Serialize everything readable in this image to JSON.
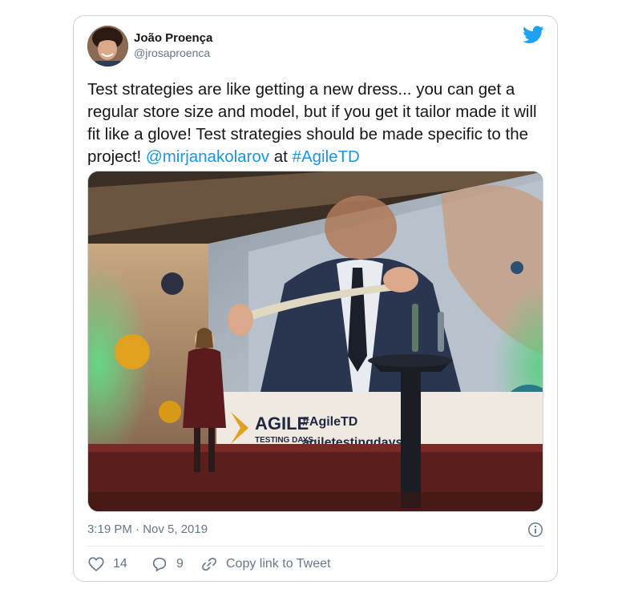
{
  "author": {
    "display_name": "João Proença",
    "handle": "@jrosaproenca",
    "avatar_icon": "avatar-photo"
  },
  "brand_icon": "twitter-bird-icon",
  "tweet": {
    "text_main": "Test strategies are like getting a new dress... you can get a regular store size and model, but if you get it tailor made it will fit like a glove! Test strategies should be made specific to the project! ",
    "mention": "@mirjanakolarov",
    "connector": " at ",
    "hashtag": "#AgileTD"
  },
  "media": {
    "banner_brand_top": "AGILE",
    "banner_brand_bottom": "TESTING DAYS",
    "banner_hashtag": "#AgileTD",
    "banner_url": "agiletestingdays.co"
  },
  "meta": {
    "timestamp": "3:19 PM · Nov 5, 2019"
  },
  "actions": {
    "like_count": "14",
    "reply_count": "9",
    "copy_label": "Copy link to Tweet"
  },
  "colors": {
    "link": "#1b95e0",
    "text_primary": "#14171a",
    "text_secondary": "#657786",
    "border": "#ccd6dd",
    "twitter_blue": "#1da1f2"
  }
}
